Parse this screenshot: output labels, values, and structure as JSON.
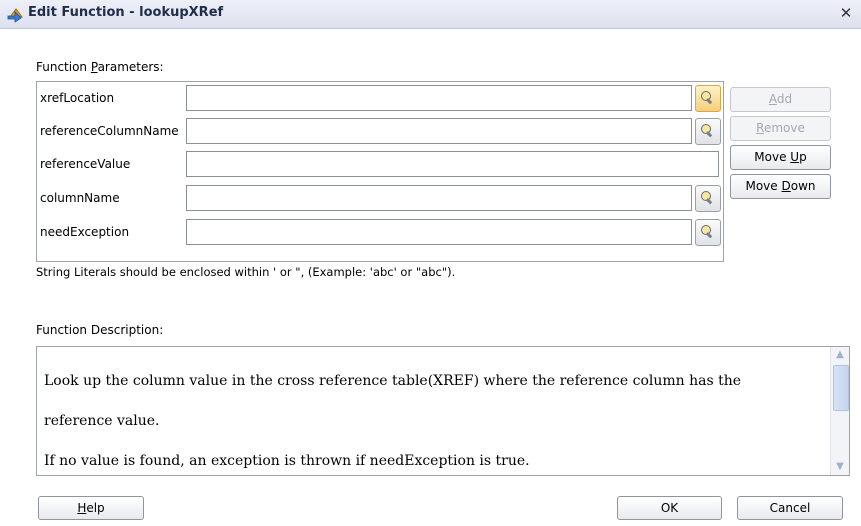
{
  "window": {
    "title": "Edit Function - lookupXRef",
    "close_glyph": "✕"
  },
  "params": {
    "label_prefix": "Function ",
    "label_mnemonic": "P",
    "label_suffix": "arameters:",
    "rows": [
      {
        "name": "xrefLocation",
        "value": "",
        "has_browse": true,
        "browse_active": true
      },
      {
        "name": "referenceColumnName",
        "value": "",
        "has_browse": true,
        "browse_active": false
      },
      {
        "name": "referenceValue",
        "value": "",
        "has_browse": false,
        "browse_active": false
      },
      {
        "name": "columnName",
        "value": "",
        "has_browse": true,
        "browse_active": false
      },
      {
        "name": "needException",
        "value": "",
        "has_browse": true,
        "browse_active": false
      }
    ],
    "browse_icon": "flashlight-icon"
  },
  "side_buttons": {
    "add": {
      "mnemonic": "A",
      "rest": "dd",
      "enabled": false
    },
    "remove": {
      "mnemonic": "R",
      "rest": "emove",
      "enabled": false
    },
    "move_up": {
      "prefix": "Move ",
      "mnemonic": "U",
      "rest": "p",
      "enabled": true
    },
    "move_down": {
      "prefix": "Move ",
      "mnemonic": "D",
      "rest": "own",
      "enabled": true
    }
  },
  "hint": "String Literals should be enclosed within ' or \", (Example: 'abc' or \"abc\").",
  "description": {
    "label": "Function Description:",
    "lines": [
      "Look up the column value in the cross reference table(XREF) where the reference column has the",
      "reference value.",
      "If no value is found, an exception is thrown if needException is true."
    ]
  },
  "footer": {
    "help": {
      "mnemonic": "H",
      "rest": "elp"
    },
    "ok": "OK",
    "cancel": "Cancel"
  },
  "colors": {
    "title_text": "#1f2d4a",
    "browse_active": "#f4cf7a",
    "disabled_text": "#a3a7ae"
  }
}
